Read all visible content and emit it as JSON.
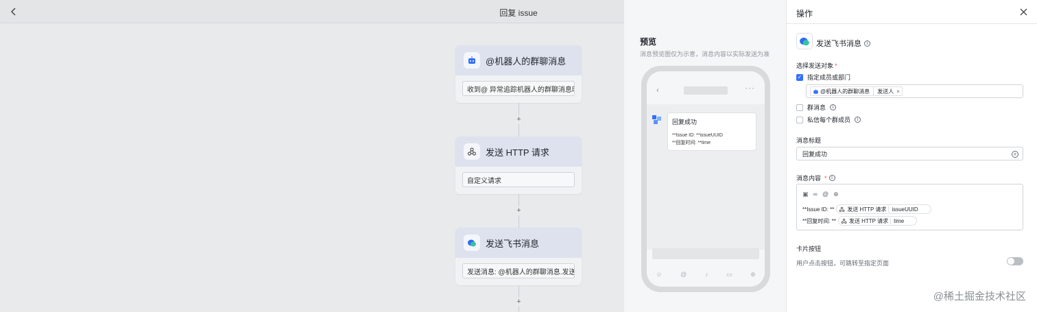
{
  "header": {
    "title": "回复 issue"
  },
  "flow": {
    "nodes": [
      {
        "title": "@机器人的群聊消息",
        "field": "收到@ 异常追踪机器人的群聊消息时",
        "icon": "robot-icon"
      },
      {
        "title": "发送 HTTP 请求",
        "field": "自定义请求",
        "icon": "webhook-icon"
      },
      {
        "title": "发送飞书消息",
        "field": "发送消息: @机器人的群聊消息.发送人",
        "icon": "feishu-message-icon"
      }
    ],
    "add_symbol": "+"
  },
  "preview": {
    "title": "预览",
    "subtitle": "消息预览图仅为示意，消息内容以实际发送为准",
    "card_title": "回复成功",
    "card_line1": "**Issue ID: **issueUUID",
    "card_line2": "**回复时间: **time"
  },
  "panel": {
    "title": "操作",
    "action_name": "发送飞书消息",
    "target_label": "选择发送对象",
    "required_mark": "*",
    "options": {
      "members": "指定成员或部门",
      "group": "群消息",
      "private": "私信每个群成员"
    },
    "member_tag": {
      "source": "@机器人的群聊消息",
      "field": "发送人",
      "remove": "×"
    },
    "msg_title_label": "消息标题",
    "msg_title_value": "回复成功",
    "msg_content_label": "消息内容",
    "content": {
      "line1_prefix": "**Issue ID: **",
      "line1_source": "发送 HTTP 请求",
      "line1_field": "issueUUID",
      "line2_prefix": "**回复时间: **",
      "line2_source": "发送 HTTP 请求",
      "line2_field": "time"
    },
    "card_button_label": "卡片按钮",
    "card_button_desc": "用户点击按钮，可跳转至指定页面"
  },
  "watermark": "@稀土掘金技术社区",
  "colors": {
    "accent": "#3370ff",
    "required": "#f54a45",
    "node_head": "#dde2ee"
  }
}
